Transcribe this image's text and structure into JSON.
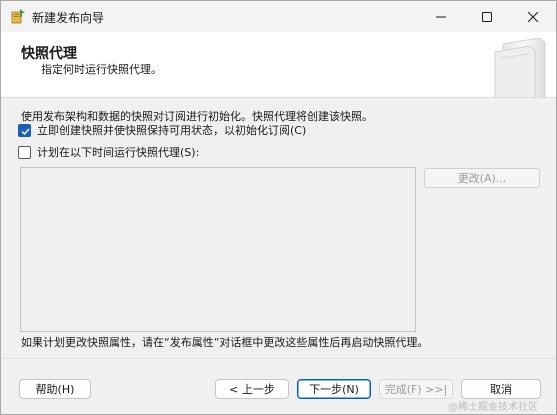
{
  "window": {
    "title": "新建发布向导"
  },
  "banner": {
    "title": "快照代理",
    "subtitle": "指定何时运行快照代理。"
  },
  "body": {
    "description": "使用发布架构和数据的快照对订阅进行初始化。快照代理将创建该快照。",
    "create_snapshot_now": {
      "label": "立即创建快照并使快照保持可用状态，以初始化订阅(C)",
      "checked": true
    },
    "schedule_snapshot": {
      "label": "计划在以下时间运行快照代理(S):",
      "checked": false
    },
    "change_button": "更改(A)...",
    "note": "如果计划更改快照属性，请在“发布属性”对话框中更改这些属性后再启动快照代理。"
  },
  "footer": {
    "help": "帮助(H)",
    "back": "< 上一步",
    "next": "下一步(N)",
    "finish": "完成(F) >>|",
    "cancel": "取消"
  },
  "watermark": "@稀土掘金技术社区",
  "colors": {
    "accent": "#1a5fb4",
    "background": "#f0f0f0",
    "banner": "#ffffff"
  }
}
